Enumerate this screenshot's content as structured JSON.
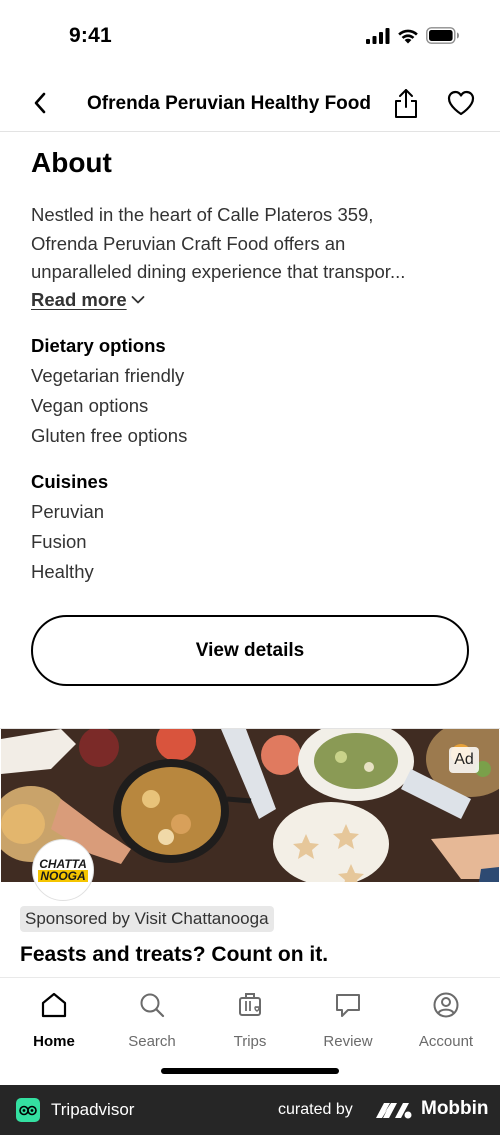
{
  "status": {
    "time": "9:41"
  },
  "nav": {
    "title": "Ofrenda Peruvian Healthy Food"
  },
  "about": {
    "title": "About",
    "lines": [
      "Nestled in the heart of Calle Plateros 359,",
      "Ofrenda Peruvian Craft Food offers an",
      "unparalleled dining experience that transpor..."
    ],
    "read_more": "Read more"
  },
  "dietary": {
    "heading": "Dietary options",
    "items": [
      "Vegetarian friendly",
      "Vegan options",
      "Gluten free options"
    ]
  },
  "cuisines": {
    "heading": "Cuisines",
    "items": [
      "Peruvian",
      "Fusion",
      "Healthy"
    ]
  },
  "view_details": "View details",
  "ad": {
    "badge": "Ad",
    "logo_line1": "CHATTA",
    "logo_line2": "NOOGA",
    "sponsored": "Sponsored by Visit Chattanooga",
    "headline": "Feasts and treats? Count on it."
  },
  "tabs": [
    {
      "label": "Home",
      "icon": "home-icon",
      "active": true
    },
    {
      "label": "Search",
      "icon": "search-icon",
      "active": false
    },
    {
      "label": "Trips",
      "icon": "trips-icon",
      "active": false
    },
    {
      "label": "Review",
      "icon": "review-icon",
      "active": false
    },
    {
      "label": "Account",
      "icon": "account-icon",
      "active": false
    }
  ],
  "footer": {
    "brand": "Tripadvisor",
    "curated_by": "curated by",
    "mobbin": "Mobbin"
  },
  "colors": {
    "footer_bg": "#262626",
    "tripadvisor_green": "#34e0a1",
    "text_secondary": "#333333"
  }
}
